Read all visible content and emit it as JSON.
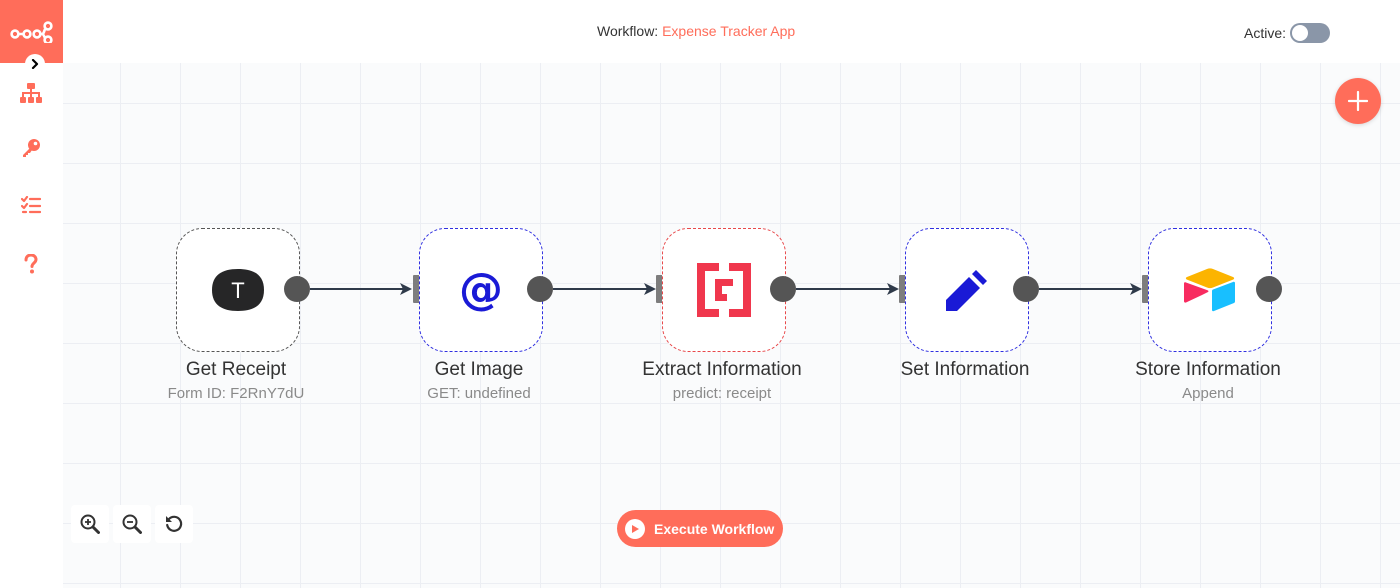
{
  "header": {
    "workflow_label": "Workflow:",
    "workflow_name": "Expense Tracker App",
    "active_label": "Active:",
    "active": false
  },
  "sidebar": {
    "items": [
      {
        "icon": "network-icon"
      },
      {
        "icon": "key-icon"
      },
      {
        "icon": "list-check-icon"
      },
      {
        "icon": "help-icon"
      }
    ]
  },
  "nodes": [
    {
      "title": "Get Receipt",
      "subtitle": "Form ID: F2RnY7dU",
      "icon": "typeform-icon",
      "icon_text": "T"
    },
    {
      "title": "Get Image",
      "subtitle": "GET: undefined",
      "icon": "at-icon",
      "icon_text": "@"
    },
    {
      "title": "Extract Information",
      "subtitle": "predict: receipt",
      "icon": "mindee-icon"
    },
    {
      "title": "Set Information",
      "subtitle": "",
      "icon": "pencil-icon"
    },
    {
      "title": "Store Information",
      "subtitle": "Append",
      "icon": "airtable-icon"
    }
  ],
  "canvas": {
    "execute_label": "Execute Workflow",
    "add_icon": "plus-icon",
    "zoom_controls": [
      "zoom-in-icon",
      "zoom-out-icon",
      "reset-icon"
    ]
  },
  "colors": {
    "brand": "#ff6d5a",
    "node_blue": "#2f2fe0",
    "node_red": "#e8484a",
    "connector": "#2f3a4a"
  }
}
